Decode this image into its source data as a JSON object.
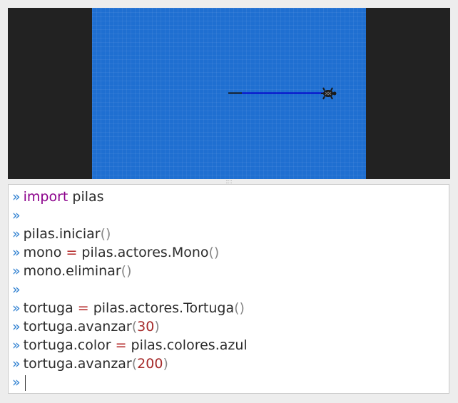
{
  "colors": {
    "stage_background": "#1f6fd1",
    "letterbox": "#222222",
    "prompt": "#2d7fd0",
    "keyword": "#8b008b",
    "operator": "#b22222",
    "number": "#a52a2a",
    "turtle_line": "#0000cc"
  },
  "console": {
    "prompt": "»",
    "lines": [
      {
        "kw": "import",
        "rest": " pilas"
      },
      {},
      {
        "a": "pilas.iniciar",
        "p": "()"
      },
      {
        "a": "mono ",
        "op": "=",
        "b": " pilas.actores.Mono",
        "p": "()"
      },
      {
        "a": "mono.eliminar",
        "p": "()"
      },
      {},
      {
        "a": "tortuga ",
        "op": "=",
        "b": " pilas.actores.Tortuga",
        "p": "()"
      },
      {
        "a": "tortuga.avanzar",
        "po": "(",
        "n": "30",
        "pc": ")"
      },
      {
        "a": "tortuga.color ",
        "op": "=",
        "b": " pilas.colores.azul"
      },
      {
        "a": "tortuga.avanzar",
        "po": "(",
        "n": "200",
        "pc": ")"
      },
      {}
    ]
  }
}
